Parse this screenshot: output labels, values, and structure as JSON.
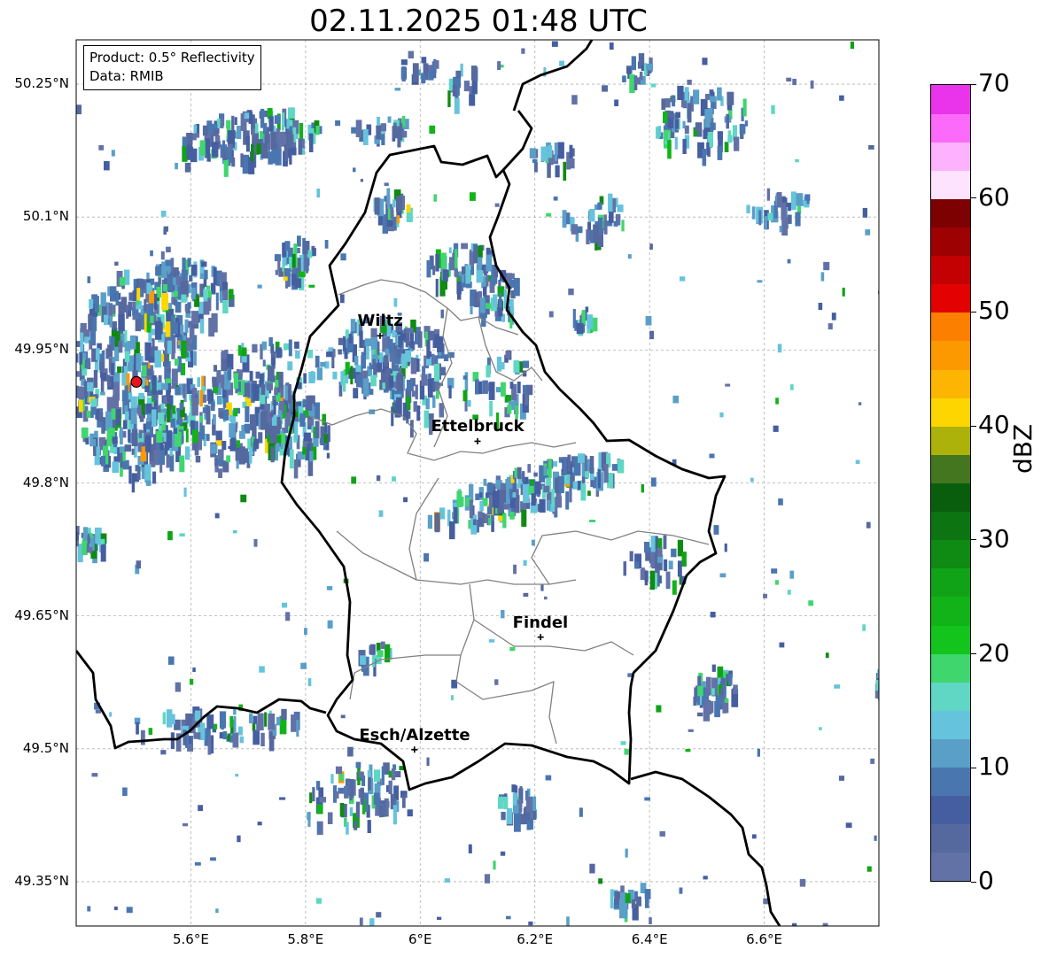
{
  "title": "02.11.2025 01:48 UTC",
  "info": {
    "product": "Product: 0.5° Reflectivity",
    "data": "Data: RMIB"
  },
  "map": {
    "lon_range": [
      5.4,
      6.8
    ],
    "lat_range": [
      49.3,
      50.3
    ],
    "x_ticks": [
      "5.6°E",
      "5.8°E",
      "6°E",
      "6.2°E",
      "6.4°E",
      "6.6°E"
    ],
    "y_ticks": [
      "50.25°N",
      "50.1°N",
      "49.95°N",
      "49.8°N",
      "49.65°N",
      "49.5°N",
      "49.35°N"
    ],
    "grid": true
  },
  "cities": [
    {
      "name": "Wiltz",
      "lon": 5.93,
      "lat": 49.966
    },
    {
      "name": "Ettelbruck",
      "lon": 6.1,
      "lat": 49.847
    },
    {
      "name": "Findel",
      "lon": 6.21,
      "lat": 49.626
    },
    {
      "name": "Esch/Alzette",
      "lon": 5.99,
      "lat": 49.499
    }
  ],
  "radar_site": {
    "lon": 5.505,
    "lat": 49.914,
    "color": "#e8141c"
  },
  "colorbar": {
    "label": "dBZ",
    "min": 0,
    "max": 70,
    "ticks": [
      "0",
      "10",
      "20",
      "30",
      "40",
      "50",
      "60",
      "70"
    ],
    "colors": [
      "#6272a6",
      "#55699f",
      "#455ea0",
      "#4a76b0",
      "#5a9fc8",
      "#66c3dc",
      "#5fd7c4",
      "#3fd66e",
      "#12c41c",
      "#12b319",
      "#11a317",
      "#0f8a12",
      "#0c7512",
      "#085e0d",
      "#43761e",
      "#adb20b",
      "#fdd600",
      "#fcb500",
      "#fc9900",
      "#fd7f00",
      "#e20201",
      "#c40102",
      "#9e0102",
      "#7d0101",
      "#fde3fe",
      "#fcb2fd",
      "#fc6afa",
      "#e934ec"
    ]
  }
}
